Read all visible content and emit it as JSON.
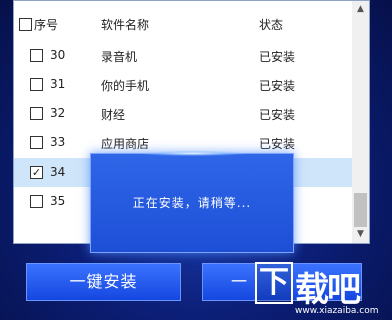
{
  "table": {
    "headers": {
      "index": "序号",
      "name": "软件名称",
      "status": "状态"
    },
    "rows": [
      {
        "checked": false,
        "num": "30",
        "name": "录音机",
        "status": "已安装"
      },
      {
        "checked": false,
        "num": "31",
        "name": "你的手机",
        "status": "已安装"
      },
      {
        "checked": false,
        "num": "32",
        "name": "财经",
        "status": "已安装"
      },
      {
        "checked": false,
        "num": "33",
        "name": "应用商店",
        "status": "已安装"
      },
      {
        "checked": true,
        "num": "34",
        "name": "",
        "status": "装"
      },
      {
        "checked": false,
        "num": "35",
        "name": "",
        "status": ""
      }
    ]
  },
  "scrollbar": {
    "up_icon": "▲",
    "down_icon": "▼"
  },
  "modal": {
    "text": "正在安装，请稍等..."
  },
  "buttons": {
    "install": "一键安装",
    "second": "一"
  },
  "watermark": {
    "box": "下",
    "title": "载吧",
    "url": "www.xiazaiba.com"
  },
  "colors": {
    "background": "#0c1f78",
    "button": "#1f55ea",
    "modal": "#2a5fe4",
    "selected_row": "#cfe5fa"
  }
}
